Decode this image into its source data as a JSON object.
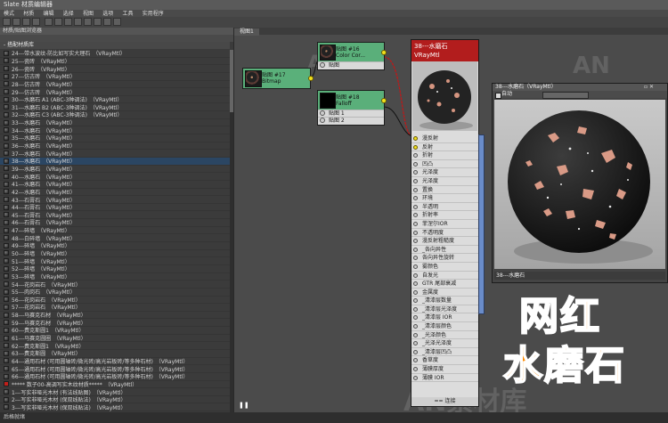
{
  "window": {
    "title": "Slate 材质编辑器"
  },
  "menu": [
    "模式",
    "材质",
    "编辑",
    "选择",
    "视图",
    "选项",
    "工具",
    "实用程序"
  ],
  "browser": {
    "title": "材质/贴图浏览器",
    "section": "- 搭配材质库",
    "items": [
      {
        "label": "24---带水波纹-防比如写实大理石　（VRayMtl）",
        "sel": false
      },
      {
        "label": "25---瓷砖　（VRayMtl）",
        "sel": false
      },
      {
        "label": "26---瓷砖　（VRayMtl）",
        "sel": false
      },
      {
        "label": "27---仿古砖　（VRayMtl）",
        "sel": false
      },
      {
        "label": "28---仿古砖　（VRayMtl）",
        "sel": false
      },
      {
        "label": "29---仿古砖　（VRayMtl）",
        "sel": false
      },
      {
        "label": "30---水磨石 A1 (ABC-3种调法)　（VRayMtl）",
        "sel": false
      },
      {
        "label": "31---水磨石 B2 (ABC-3种调法)　（VRayMtl）",
        "sel": false
      },
      {
        "label": "32---水磨石 C3 (ABC-3种调法)　（VRayMtl）",
        "sel": false
      },
      {
        "label": "33---水磨石　（VRayMtl）",
        "sel": false
      },
      {
        "label": "34---水磨石　（VRayMtl）",
        "sel": false
      },
      {
        "label": "35---水磨石　（VRayMtl）",
        "sel": false
      },
      {
        "label": "36---水磨石　（VRayMtl）",
        "sel": false
      },
      {
        "label": "37---水磨石　（VRayMtl）",
        "sel": false
      },
      {
        "label": "38---水磨石　（VRayMtl）",
        "sel": true
      },
      {
        "label": "39---水磨石　（VRayMtl）",
        "sel": false
      },
      {
        "label": "40---水磨石　（VRayMtl）",
        "sel": false
      },
      {
        "label": "41---水磨石　（VRayMtl）",
        "sel": false
      },
      {
        "label": "42---水磨石　（VRayMtl）",
        "sel": false
      },
      {
        "label": "43---石膏石　（VRayMtl）",
        "sel": false
      },
      {
        "label": "44---石膏石　（VRayMtl）",
        "sel": false
      },
      {
        "label": "45---石膏石　（VRayMtl）",
        "sel": false
      },
      {
        "label": "46---石膏石　（VRayMtl）",
        "sel": false
      },
      {
        "label": "47---碎墙　（VRayMtl）",
        "sel": false
      },
      {
        "label": "48---白碎墙　（VRayMtl）",
        "sel": false
      },
      {
        "label": "49---碎墙　（VRayMtl）",
        "sel": false
      },
      {
        "label": "50---碎墙　（VRayMtl）",
        "sel": false
      },
      {
        "label": "51---碎墙　（VRayMtl）",
        "sel": false
      },
      {
        "label": "52---碎墙　（VRayMtl）",
        "sel": false
      },
      {
        "label": "53---碎墙　（VRayMtl）",
        "sel": false
      },
      {
        "label": "54---花岗岩石　（VRayMtl）",
        "sel": false
      },
      {
        "label": "55---肉岗石　（VRayMtl）",
        "sel": false
      },
      {
        "label": "56---花岗岩石　（VRayMtl）",
        "sel": false
      },
      {
        "label": "57---花岗岩石　（VRayMtl）",
        "sel": false
      },
      {
        "label": "58---马赛克石材　（VRayMtl）",
        "sel": false
      },
      {
        "label": "59---马赛克石材　（VRayMtl）",
        "sel": false
      },
      {
        "label": "60---费克斯圆1　（VRayMtl）",
        "sel": false
      },
      {
        "label": "61---马赛克圆圈　（VRayMtl）",
        "sel": false
      },
      {
        "label": "62---费克斯圆1　（VRayMtl）",
        "sel": false
      },
      {
        "label": "63---费克斯圆　（VRayMtl）",
        "sel": false
      },
      {
        "label": "64---通用石材 (可用圆轴砖/微光砖/高光岩板砖/等多种石材)　（VRayMtl）",
        "sel": false
      },
      {
        "label": "65---通用石材 (可用圆轴砖/微光砖/高光岩板砖/等多种石材)　（VRayMtl）",
        "sel": false
      },
      {
        "label": "66---通用石材 (可用圆轴砖/微光砖/高光岩板砖/等多种石材)　（VRayMtl）",
        "sel": false
      },
      {
        "label": "***** 数子00-高调写实木纹材质*****　（VRayMtl）",
        "sel": false,
        "red": true
      },
      {
        "label": "1---写实非哑光木材 (有法线贴图)　（VRayMtl）",
        "sel": false
      },
      {
        "label": "2---写实非哑光木材 (保双线贴法)　（VRayMtl）",
        "sel": false
      },
      {
        "label": "3---写实非哑光木材 (保双线贴法)　（VRayMtl）",
        "sel": false
      }
    ]
  },
  "view_tab": "视图1",
  "nodes": {
    "bitmap": {
      "title": "贴图 #17",
      "subtitle": "Bitmap"
    },
    "color_correct": {
      "title": "贴图 #16",
      "subtitle": "Color Cor...",
      "slot": "贴图"
    },
    "falloff": {
      "title": "贴图 #18",
      "subtitle": "Falloff",
      "slots": [
        "贴图 1",
        "贴图 2"
      ]
    },
    "vray": {
      "name": "38---水磨石",
      "type": "VRayMtl",
      "slots": [
        "漫反射",
        "反射",
        "折射",
        "凹凸",
        "光泽度",
        "光泽度",
        "置换",
        "环境",
        "半透明",
        "折射率",
        "菲涅尔IOR",
        "不透明度",
        "漫反射粗糙度",
        "_各向异性",
        "各向异性旋转",
        "雾颜色",
        "自发光",
        "GTR 尾部衰减",
        "金属度",
        "_清漆层数量",
        "_清漆层光泽度",
        "_清漆层 IOR",
        "_清漆层颜色",
        "_光泽颜色",
        "_光泽光泽度",
        "_清漆层凹凸",
        "香草度",
        "薄膜厚度",
        "薄膜 IOR"
      ],
      "more": "== 连接"
    }
  },
  "preview": {
    "title": "38---水磨石（VRayMtl）",
    "auto_label": "自动",
    "caption": "38---水磨石"
  },
  "watermark": {
    "small": "AN",
    "big": "AN素材库"
  },
  "promo": {
    "line1": "网红",
    "line2": "水磨石"
  },
  "status": "后格就绪"
}
